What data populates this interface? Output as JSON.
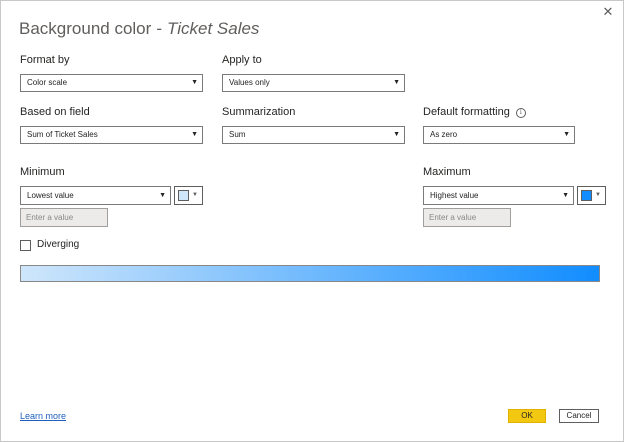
{
  "dialog": {
    "title_prefix": "Background color",
    "title_separator": "-",
    "title_field": "Ticket Sales",
    "close_glyph": "✕"
  },
  "format_by": {
    "label": "Format by",
    "value": "Color scale"
  },
  "apply_to": {
    "label": "Apply to",
    "value": "Values only"
  },
  "based_on_field": {
    "label": "Based on field",
    "value": "Sum of Ticket Sales"
  },
  "summarization": {
    "label": "Summarization",
    "value": "Sum"
  },
  "default_formatting": {
    "label": "Default formatting",
    "info_glyph": "i",
    "value": "As zero"
  },
  "minimum": {
    "label": "Minimum",
    "value": "Lowest value",
    "placeholder": "Enter a value",
    "color": "#cfe6fb"
  },
  "maximum": {
    "label": "Maximum",
    "value": "Highest value",
    "placeholder": "Enter a value",
    "color": "#118dff"
  },
  "diverging": {
    "label": "Diverging",
    "checked": false
  },
  "gradient": {
    "start_color": "#cfe6fb",
    "end_color": "#118dff"
  },
  "footer": {
    "learn_more": "Learn more",
    "ok_label": "OK",
    "cancel_label": "Cancel",
    "ok_color": "#f2c811"
  },
  "icons": {
    "dropdown": "▼"
  }
}
